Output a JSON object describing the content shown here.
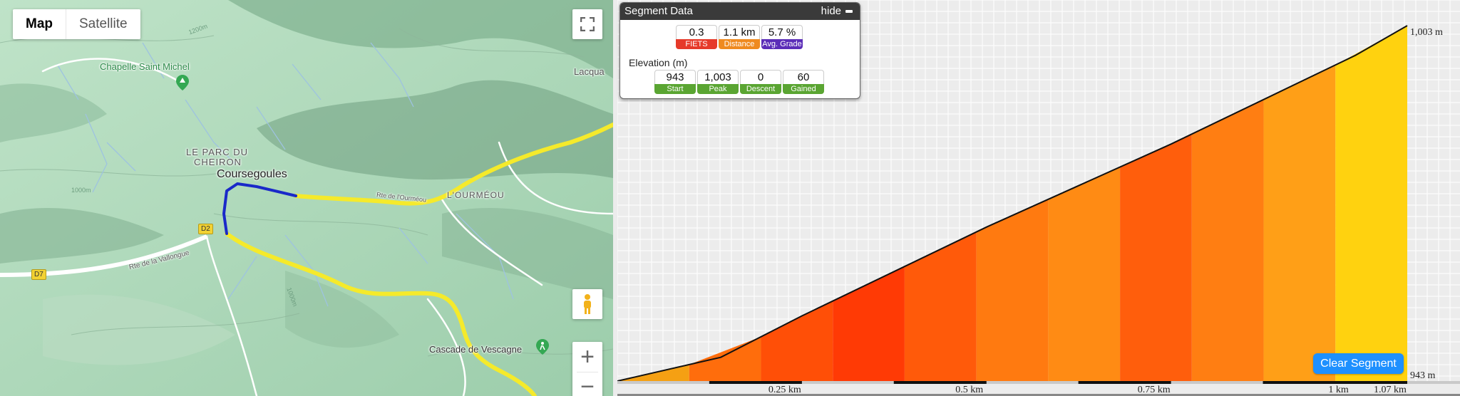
{
  "map": {
    "type_buttons": {
      "map": "Map",
      "satellite": "Satellite"
    },
    "zoom": {
      "in": "+",
      "out": "−"
    },
    "labels": {
      "chapelle": "Chapelle Saint Michel",
      "lacqua": "Lacqua",
      "parc_line1": "LE PARC DU",
      "parc_line2": "CHEIRON",
      "coursegoules": "Coursegoules",
      "ourmeou": "L'OURMÉOU",
      "route_vallongue": "Rte de la Vallongue",
      "cascade": "Cascade de Vescagne",
      "d2": "D2",
      "d7": "D7",
      "rte_road": "Rte de l'Ourméou",
      "contour_1000a": "1000m",
      "contour_1000b": "1000m",
      "contour_1200": "1200m"
    }
  },
  "segment_panel": {
    "title": "Segment Data",
    "hide_label": "hide",
    "stats": [
      {
        "value": "0.3",
        "label": "FIETS",
        "color": "#e63a2a"
      },
      {
        "value": "1.1 km",
        "label": "Distance",
        "color": "#ef8a1f"
      },
      {
        "value": "5.7 %",
        "label": "Avg. Grade",
        "color": "#5b2db8"
      }
    ],
    "elevation_title": "Elevation (m)",
    "elevation": [
      {
        "value": "943",
        "label": "Start",
        "color": "#5aa532"
      },
      {
        "value": "1,003",
        "label": "Peak",
        "color": "#5aa532"
      },
      {
        "value": "0",
        "label": "Descent",
        "color": "#5aa532"
      },
      {
        "value": "60",
        "label": "Gained",
        "color": "#5aa532"
      }
    ]
  },
  "profile": {
    "top_label": "1,003 m",
    "bottom_label": "943 m",
    "x_ticks": [
      "0.25 km",
      "0.5 km",
      "0.75 km",
      "1 km",
      "1.07 km"
    ],
    "clear_button": "Clear Segment"
  },
  "chart_data": {
    "type": "area",
    "x": [
      0,
      0.14,
      0.25,
      0.5,
      0.75,
      1.0,
      1.07
    ],
    "y": [
      943,
      947,
      954,
      969,
      983,
      998,
      1003
    ],
    "ylim": [
      943,
      1003
    ],
    "xlim": [
      0,
      1.07
    ],
    "x_ticks": [
      "0.25 km",
      "0.5 km",
      "0.75 km",
      "1 km",
      "1.07 km"
    ],
    "grid": true,
    "colors": [
      "#f5a013",
      "#ff6d0c",
      "#ff4f07",
      "#ff3a05",
      "#ff5a0a",
      "#ff7a10",
      "#ff8b14",
      "#ff5e0c",
      "#ff7e12",
      "#ff9f17",
      "#ffd20f"
    ]
  }
}
